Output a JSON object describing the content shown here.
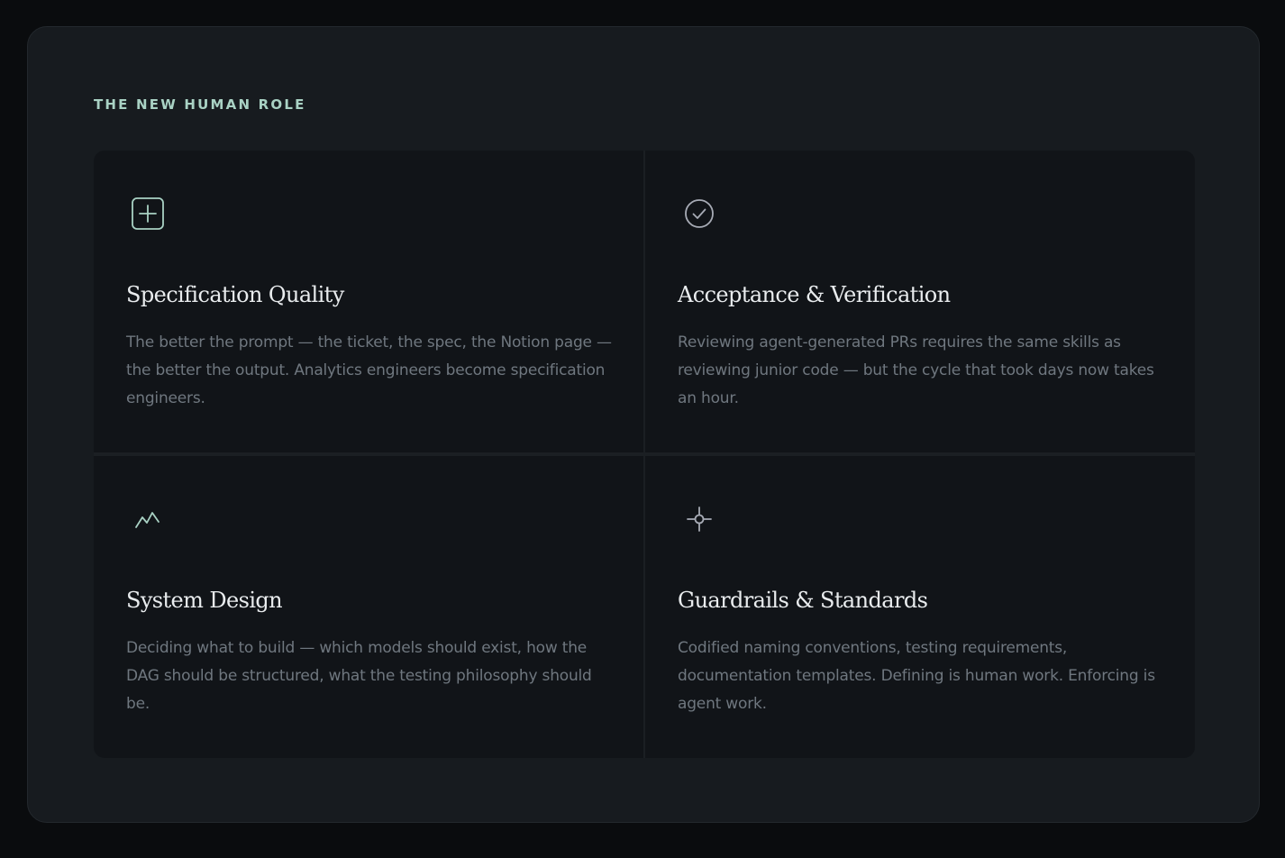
{
  "section": {
    "eyebrow": "THE NEW HUMAN ROLE"
  },
  "cards": [
    {
      "icon": "plus-square-icon",
      "title": "Specification Quality",
      "body": "The better the prompt — the ticket, the spec, the Notion page — the better the output. Analytics engineers become specification engineers."
    },
    {
      "icon": "check-circle-icon",
      "title": "Acceptance & Verification",
      "body": "Reviewing agent-generated PRs requires the same skills as reviewing junior code — but the cycle that took days now takes an hour."
    },
    {
      "icon": "activity-line-icon",
      "title": "System Design",
      "body": "Deciding what to build — which models should exist, how the DAG should be structured, what the testing philosophy should be."
    },
    {
      "icon": "crosshair-icon",
      "title": "Guardrails & Standards",
      "body": "Codified naming conventions, testing requirements, documentation templates. Defining is human work. Enforcing is agent work."
    }
  ],
  "colors": {
    "accent": "#a9d2c4",
    "secondary_icon": "#a7abb5",
    "panel": "#171b1f",
    "card": "#111418"
  }
}
